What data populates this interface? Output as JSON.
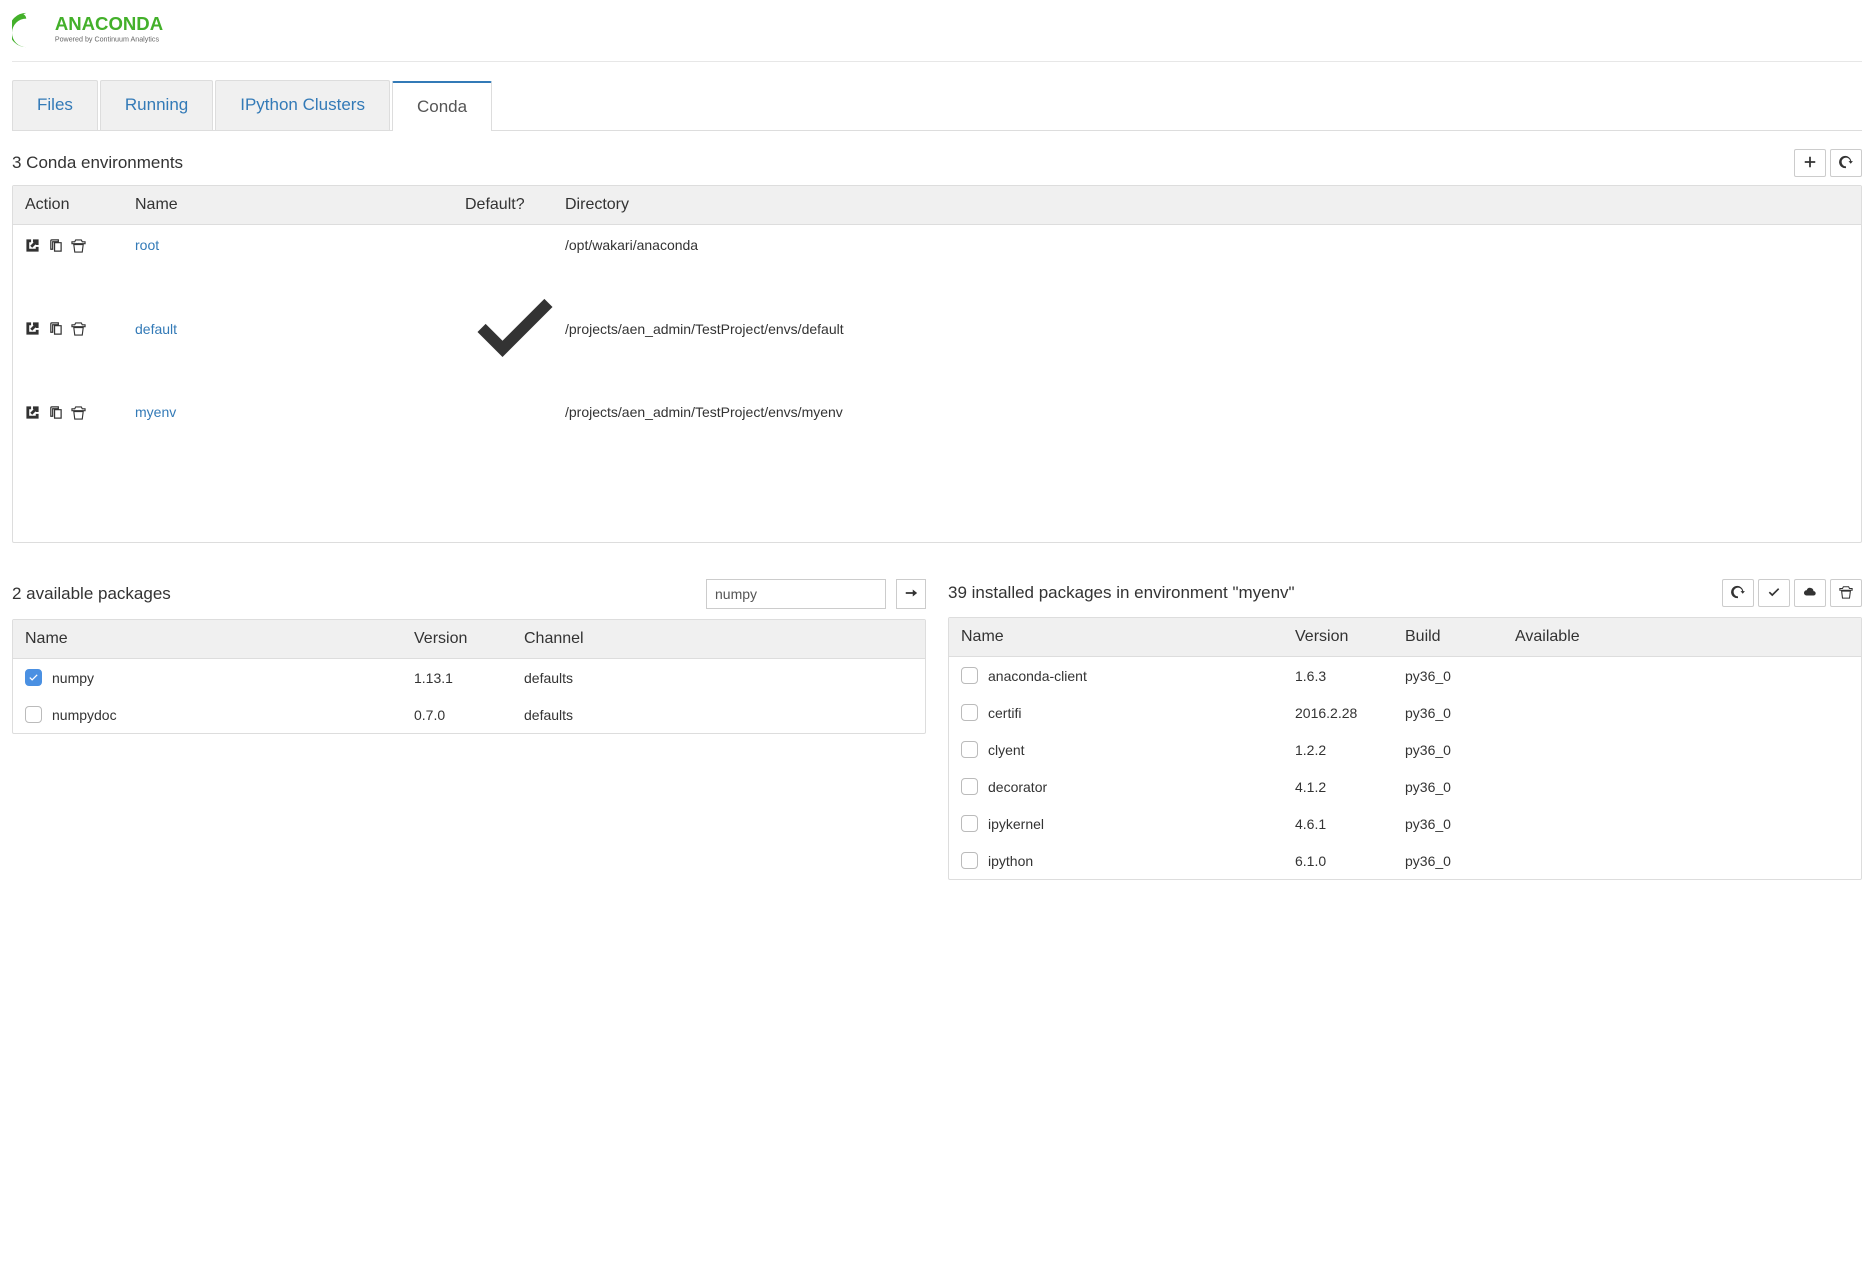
{
  "brand": {
    "name": "ANACONDA",
    "tagline": "Powered by Continuum Analytics"
  },
  "tabs": [
    {
      "label": "Files",
      "active": false
    },
    {
      "label": "Running",
      "active": false
    },
    {
      "label": "IPython Clusters",
      "active": false
    },
    {
      "label": "Conda",
      "active": true
    }
  ],
  "env_section": {
    "title": "3 Conda environments",
    "headers": {
      "action": "Action",
      "name": "Name",
      "default": "Default?",
      "directory": "Directory"
    },
    "rows": [
      {
        "name": "root",
        "default": false,
        "directory": "/opt/wakari/anaconda"
      },
      {
        "name": "default",
        "default": true,
        "directory": "/projects/aen_admin/TestProject/envs/default"
      },
      {
        "name": "myenv",
        "default": false,
        "directory": "/projects/aen_admin/TestProject/envs/myenv"
      }
    ]
  },
  "available": {
    "title": "2 available packages",
    "search_value": "numpy",
    "headers": {
      "name": "Name",
      "version": "Version",
      "channel": "Channel"
    },
    "rows": [
      {
        "name": "numpy",
        "version": "1.13.1",
        "channel": "defaults",
        "checked": true
      },
      {
        "name": "numpydoc",
        "version": "0.7.0",
        "channel": "defaults",
        "checked": false
      }
    ]
  },
  "installed": {
    "title": "39 installed packages in environment \"myenv\"",
    "headers": {
      "name": "Name",
      "version": "Version",
      "build": "Build",
      "available": "Available"
    },
    "rows": [
      {
        "name": "anaconda-client",
        "version": "1.6.3",
        "build": "py36_0",
        "available": ""
      },
      {
        "name": "certifi",
        "version": "2016.2.28",
        "build": "py36_0",
        "available": ""
      },
      {
        "name": "clyent",
        "version": "1.2.2",
        "build": "py36_0",
        "available": ""
      },
      {
        "name": "decorator",
        "version": "4.1.2",
        "build": "py36_0",
        "available": ""
      },
      {
        "name": "ipykernel",
        "version": "4.6.1",
        "build": "py36_0",
        "available": ""
      },
      {
        "name": "ipython",
        "version": "6.1.0",
        "build": "py36_0",
        "available": ""
      }
    ]
  }
}
